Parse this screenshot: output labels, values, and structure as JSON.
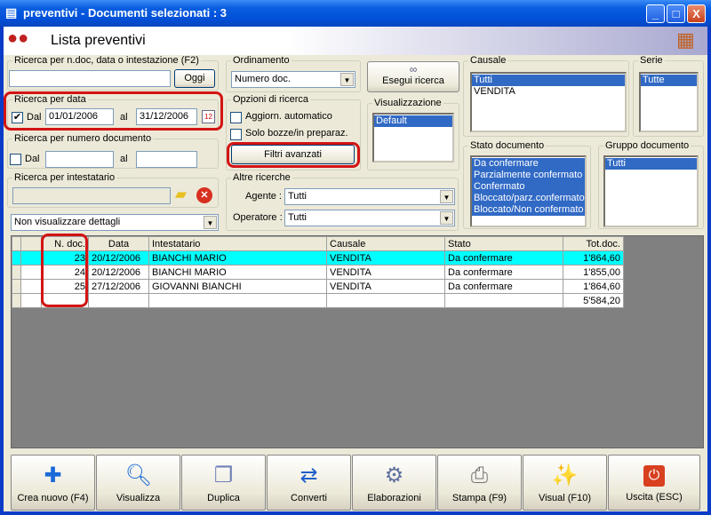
{
  "window": {
    "title": "preventivi - Documenti selezionati : 3",
    "minimize": "_",
    "maximize": "□",
    "close": "X"
  },
  "header": {
    "title": "Lista preventivi"
  },
  "search_text": {
    "legend": "Ricerca per n.doc, data o intestazione (F2)",
    "value": "",
    "today_button": "Oggi"
  },
  "search_date": {
    "legend": "Ricerca per data",
    "checked": true,
    "from_label": "Dal",
    "from": "01/01/2006",
    "to_label": "al",
    "to": "31/12/2006"
  },
  "search_number": {
    "legend": "Ricerca per numero documento",
    "checked": false,
    "from_label": "Dal",
    "from": "",
    "to_label": "al",
    "to": ""
  },
  "search_holder": {
    "legend": "Ricerca per intestatario",
    "value": ""
  },
  "details_combo": {
    "value": "Non visualizzare dettagli"
  },
  "ordering": {
    "legend": "Ordinamento",
    "value": "Numero doc."
  },
  "options": {
    "legend": "Opzioni di ricerca",
    "auto_update": "Aggiorn. automatico",
    "drafts_only": "Solo bozze/in preparaz.",
    "advanced_filters": "Filtri avanzati"
  },
  "other": {
    "legend": "Altre ricerche",
    "agent_label": "Agente :",
    "agent": "Tutti",
    "operator_label": "Operatore :",
    "operator": "Tutti"
  },
  "run_search": "Esegui ricerca",
  "view": {
    "legend": "Visualizzazione",
    "items": [
      "Default"
    ]
  },
  "causale": {
    "legend": "Causale",
    "items": [
      "Tutti",
      "VENDITA"
    ]
  },
  "serie": {
    "legend": "Serie",
    "items": [
      "Tutte"
    ]
  },
  "stato": {
    "legend": "Stato documento",
    "items": [
      "Da confermare",
      "Parzialmente confermato",
      "Confermato",
      "Bloccato/parz.confermato",
      "Bloccato/Non confermato"
    ]
  },
  "gruppo": {
    "legend": "Gruppo documento",
    "items": [
      "Tutti"
    ]
  },
  "grid": {
    "columns": [
      "N. doc.",
      "Data",
      "Intestatario",
      "Causale",
      "Stato",
      "Tot.doc."
    ],
    "rows": [
      [
        "23",
        "20/12/2006",
        "BIANCHI MARIO",
        "VENDITA",
        "Da confermare",
        "1'864,60"
      ],
      [
        "24",
        "20/12/2006",
        "BIANCHI MARIO",
        "VENDITA",
        "Da confermare",
        "1'855,00"
      ],
      [
        "25",
        "27/12/2006",
        "GIOVANNI BIANCHI",
        "VENDITA",
        "Da confermare",
        "1'864,60"
      ]
    ],
    "total": "5'584,20"
  },
  "toolbar": [
    "Crea nuovo (F4)",
    "Visualizza",
    "Duplica",
    "Converti",
    "Elaborazioni",
    "Stampa (F9)",
    "Visual (F10)",
    "Uscita (ESC)"
  ]
}
